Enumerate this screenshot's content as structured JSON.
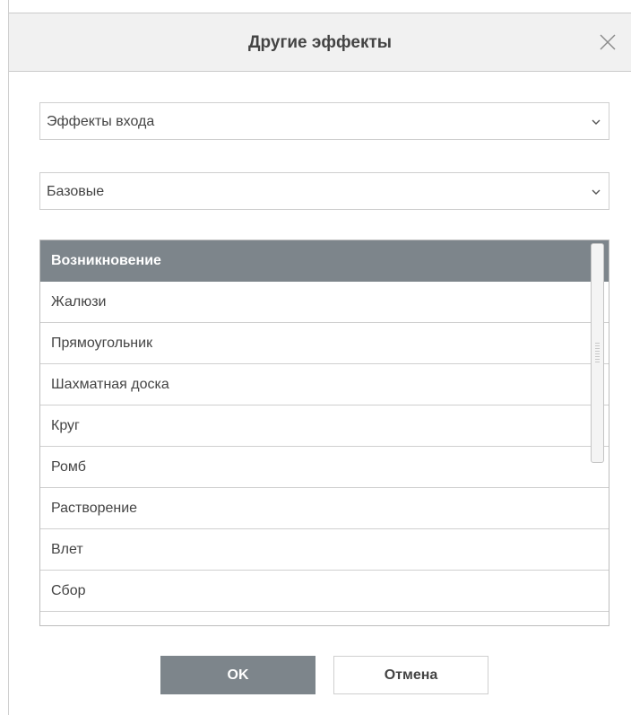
{
  "dialog": {
    "title": "Другие эффекты",
    "close_icon": "close-icon"
  },
  "category_select": {
    "value": "Эффекты входа",
    "icon": "chevron-down-icon"
  },
  "group_select": {
    "value": "Базовые",
    "icon": "chevron-down-icon"
  },
  "effects": {
    "selected_index": 0,
    "items": [
      {
        "label": "Возникновение"
      },
      {
        "label": "Жалюзи"
      },
      {
        "label": "Прямоугольник"
      },
      {
        "label": "Шахматная доска"
      },
      {
        "label": "Круг"
      },
      {
        "label": "Ромб"
      },
      {
        "label": "Растворение"
      },
      {
        "label": "Влет"
      },
      {
        "label": "Сбор"
      }
    ]
  },
  "buttons": {
    "ok_label": "OK",
    "cancel_label": "Отмена"
  },
  "colors": {
    "selected_bg": "#7d858b",
    "titlebar_bg": "#f1f1f1",
    "text": "#444444"
  }
}
